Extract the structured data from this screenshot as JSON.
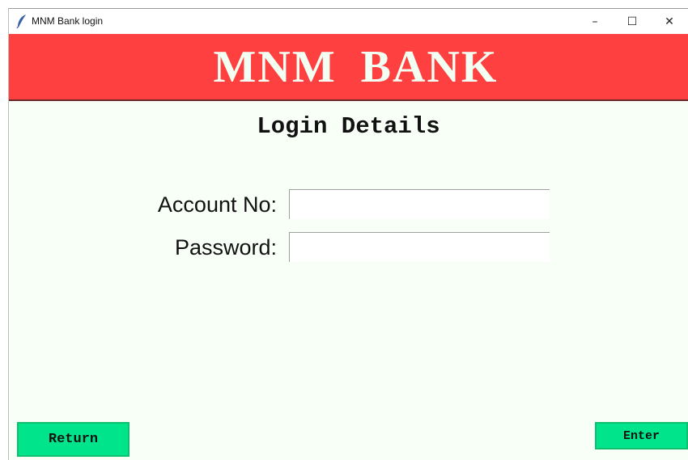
{
  "window": {
    "title": "MNM Bank login",
    "controls": {
      "minimize": "–",
      "maximize": "☐",
      "close": "✕"
    },
    "app_icon": "feather-icon"
  },
  "header": {
    "bank_name": "MNM BANK",
    "background_color": "#ff4040"
  },
  "form": {
    "title": "Login Details",
    "account_label": "Account No:",
    "account_value": "",
    "password_label": "Password:",
    "password_value": ""
  },
  "buttons": {
    "return_label": "Return",
    "enter_label": "Enter",
    "color": "#00e58c"
  },
  "body_background": "#f7fff7"
}
